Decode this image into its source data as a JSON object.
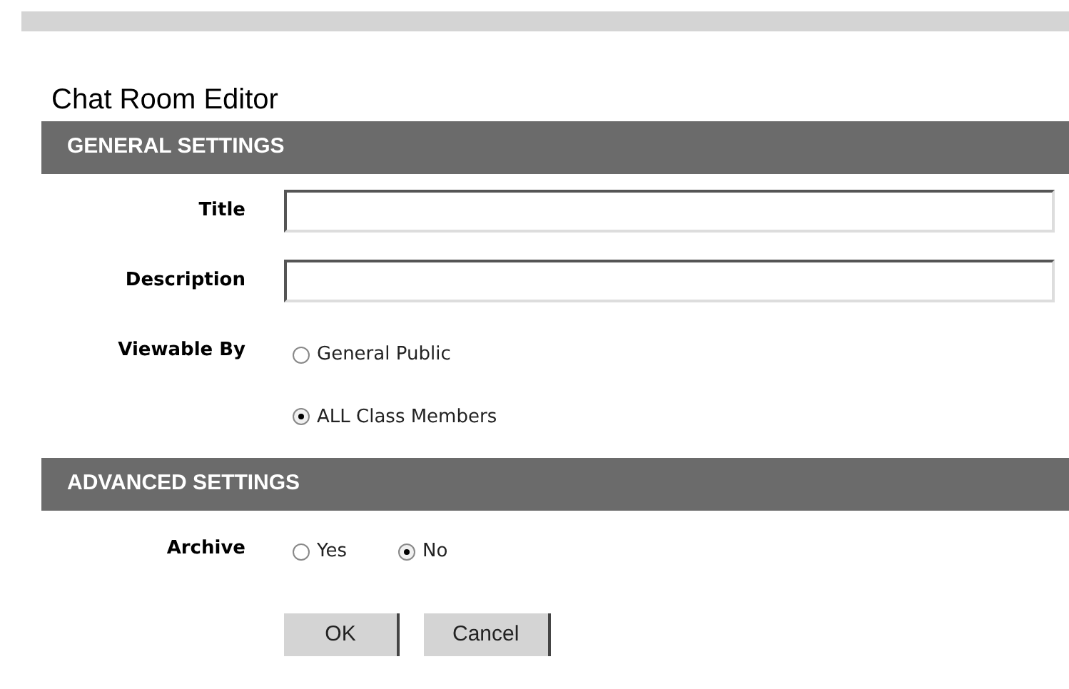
{
  "title": "Chat Room Editor",
  "sections": [
    {
      "heading": "GENERAL SETTINGS",
      "fields": [
        {
          "kind": "text",
          "label": "Title"
        },
        {
          "kind": "text",
          "label": "Description"
        },
        {
          "kind": "radio_stacked",
          "label": "Viewable By",
          "options": [
            {
              "label": "General Public",
              "selected": false
            },
            {
              "label": "ALL Class Members",
              "selected": true
            }
          ]
        }
      ]
    },
    {
      "heading": "ADVANCED SETTINGS",
      "fields": [
        {
          "kind": "radio_inline",
          "label": "Archive",
          "options": [
            {
              "label": "Yes",
              "selected": false
            },
            {
              "label": "No",
              "selected": true
            }
          ]
        }
      ]
    }
  ],
  "buttons": [
    "OK",
    "Cancel"
  ]
}
